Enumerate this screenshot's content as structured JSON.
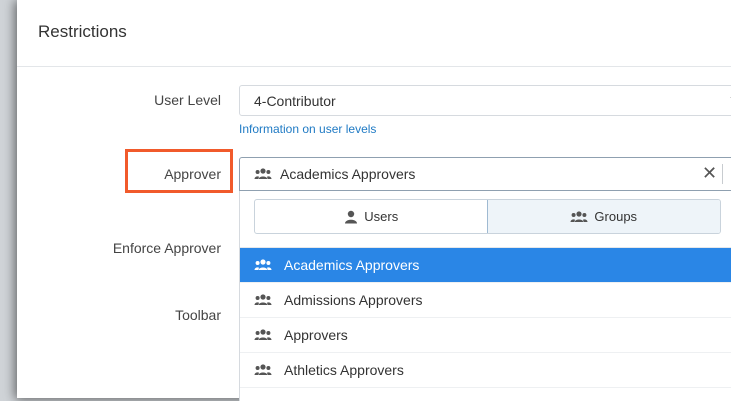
{
  "panel": {
    "title": "Restrictions"
  },
  "form": {
    "user_level": {
      "label": "User Level",
      "value": "4-Contributor",
      "help_link": "Information on user levels"
    },
    "approver": {
      "label": "Approver",
      "value": "Academics Approvers"
    },
    "enforce_approver": {
      "label": "Enforce Approver"
    },
    "toolbar": {
      "label": "Toolbar"
    }
  },
  "dropdown": {
    "toggle": {
      "users_label": "Users",
      "groups_label": "Groups",
      "active": "Groups"
    },
    "options": [
      {
        "label": "Academics Approvers",
        "selected": true
      },
      {
        "label": "Admissions Approvers",
        "selected": false
      },
      {
        "label": "Approvers",
        "selected": false
      },
      {
        "label": "Athletics Approvers",
        "selected": false
      }
    ]
  },
  "colors": {
    "accent": "#2a86e6",
    "highlight": "#f15a2b",
    "link": "#1f7ac4"
  },
  "icons": {
    "group": "group-icon",
    "user": "user-icon",
    "clear": "clear-icon",
    "chevron": "chevron-down-icon"
  }
}
